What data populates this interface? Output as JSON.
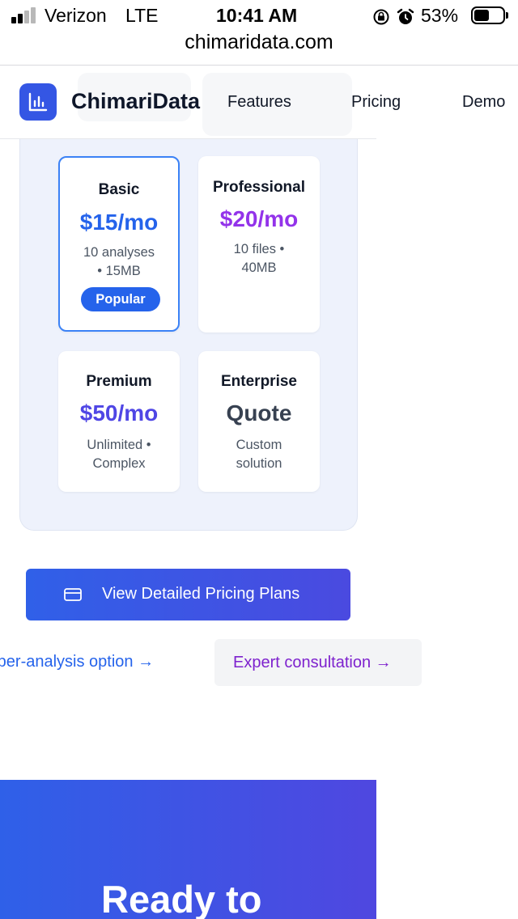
{
  "status_bar": {
    "carrier": "Verizon",
    "network": "LTE",
    "time": "10:41 AM",
    "battery": "53%",
    "battery_level": 0.53
  },
  "browser": {
    "url": "chimaridata.com"
  },
  "nav": {
    "brand": "ChimariData",
    "links": [
      "Features",
      "Pricing",
      "Demo"
    ]
  },
  "plans": [
    {
      "name": "Basic",
      "price": "$15/mo",
      "desc_line1": "10 analyses",
      "desc_line2": "• 15MB",
      "badge": "Popular"
    },
    {
      "name": "Professional",
      "price": "$20/mo",
      "desc_line1": "10 files •",
      "desc_line2": "40MB"
    },
    {
      "name": "Premium",
      "price": "$50/mo",
      "desc_line1": "Unlimited •",
      "desc_line2": "Complex"
    },
    {
      "name": "Enterprise",
      "price": "Quote",
      "desc_line1": "Custom",
      "desc_line2": "solution"
    }
  ],
  "colors": {
    "basic_price": "#2563eb",
    "professional_price": "#9333ea",
    "premium_price": "#4f46e5",
    "enterprise_price": "#374151"
  },
  "actions": {
    "detailed_pricing": "View Detailed Pricing Plans",
    "pay_per_analysis": "-per-analysis option →",
    "expert_consultation": "Expert consultation →"
  },
  "hero": {
    "title": "Ready to"
  }
}
